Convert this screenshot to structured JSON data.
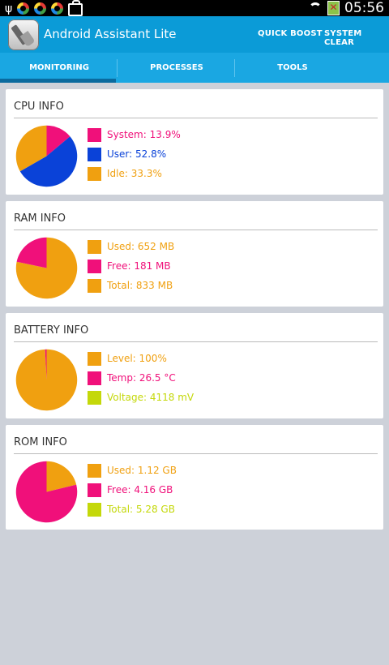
{
  "status_bar": {
    "time": "05:56"
  },
  "app": {
    "title": "Android Assistant Lite",
    "actions": [
      "QUICK BOOST",
      "SYSTEM CLEAR"
    ]
  },
  "tabs": [
    {
      "label": "MONITORING",
      "active": true
    },
    {
      "label": "PROCESSES",
      "active": false
    },
    {
      "label": "TOOLS",
      "active": false
    }
  ],
  "colors": {
    "magenta": "#f0107a",
    "blue": "#0a42d8",
    "orange": "#f0a010",
    "lime": "#c4d80a"
  },
  "cards": [
    {
      "title": "CPU INFO",
      "pie": [
        {
          "pct": 13.9,
          "color": "#f0107a"
        },
        {
          "pct": 52.8,
          "color": "#0a42d8"
        },
        {
          "pct": 33.3,
          "color": "#f0a010"
        }
      ],
      "items": [
        {
          "label": "System: 13.9%",
          "color": "#f0107a"
        },
        {
          "label": "User: 52.8%",
          "color": "#0a42d8"
        },
        {
          "label": "Idle: 33.3%",
          "color": "#f0a010"
        }
      ]
    },
    {
      "title": "RAM INFO",
      "pie": [
        {
          "pct": 78.3,
          "color": "#f0a010"
        },
        {
          "pct": 21.7,
          "color": "#f0107a"
        }
      ],
      "items": [
        {
          "label": "Used: 652 MB",
          "color": "#f0a010"
        },
        {
          "label": "Free: 181 MB",
          "color": "#f0107a"
        },
        {
          "label": "Total: 833 MB",
          "color": "#f0a010"
        }
      ]
    },
    {
      "title": "BATTERY INFO",
      "pie": [
        {
          "pct": 99.2,
          "color": "#f0a010"
        },
        {
          "pct": 0.8,
          "color": "#f0107a"
        }
      ],
      "items": [
        {
          "label": "Level: 100%",
          "color": "#f0a010"
        },
        {
          "label": "Temp: 26.5 °C",
          "color": "#f0107a"
        },
        {
          "label": "Voltage: 4118 mV",
          "color": "#c4d80a"
        }
      ]
    },
    {
      "title": "ROM INFO",
      "pie": [
        {
          "pct": 21.2,
          "color": "#f0a010"
        },
        {
          "pct": 78.8,
          "color": "#f0107a"
        }
      ],
      "items": [
        {
          "label": "Used: 1.12 GB",
          "color": "#f0a010"
        },
        {
          "label": "Free: 4.16 GB",
          "color": "#f0107a"
        },
        {
          "label": "Total: 5.28 GB",
          "color": "#c4d80a"
        }
      ]
    }
  ]
}
